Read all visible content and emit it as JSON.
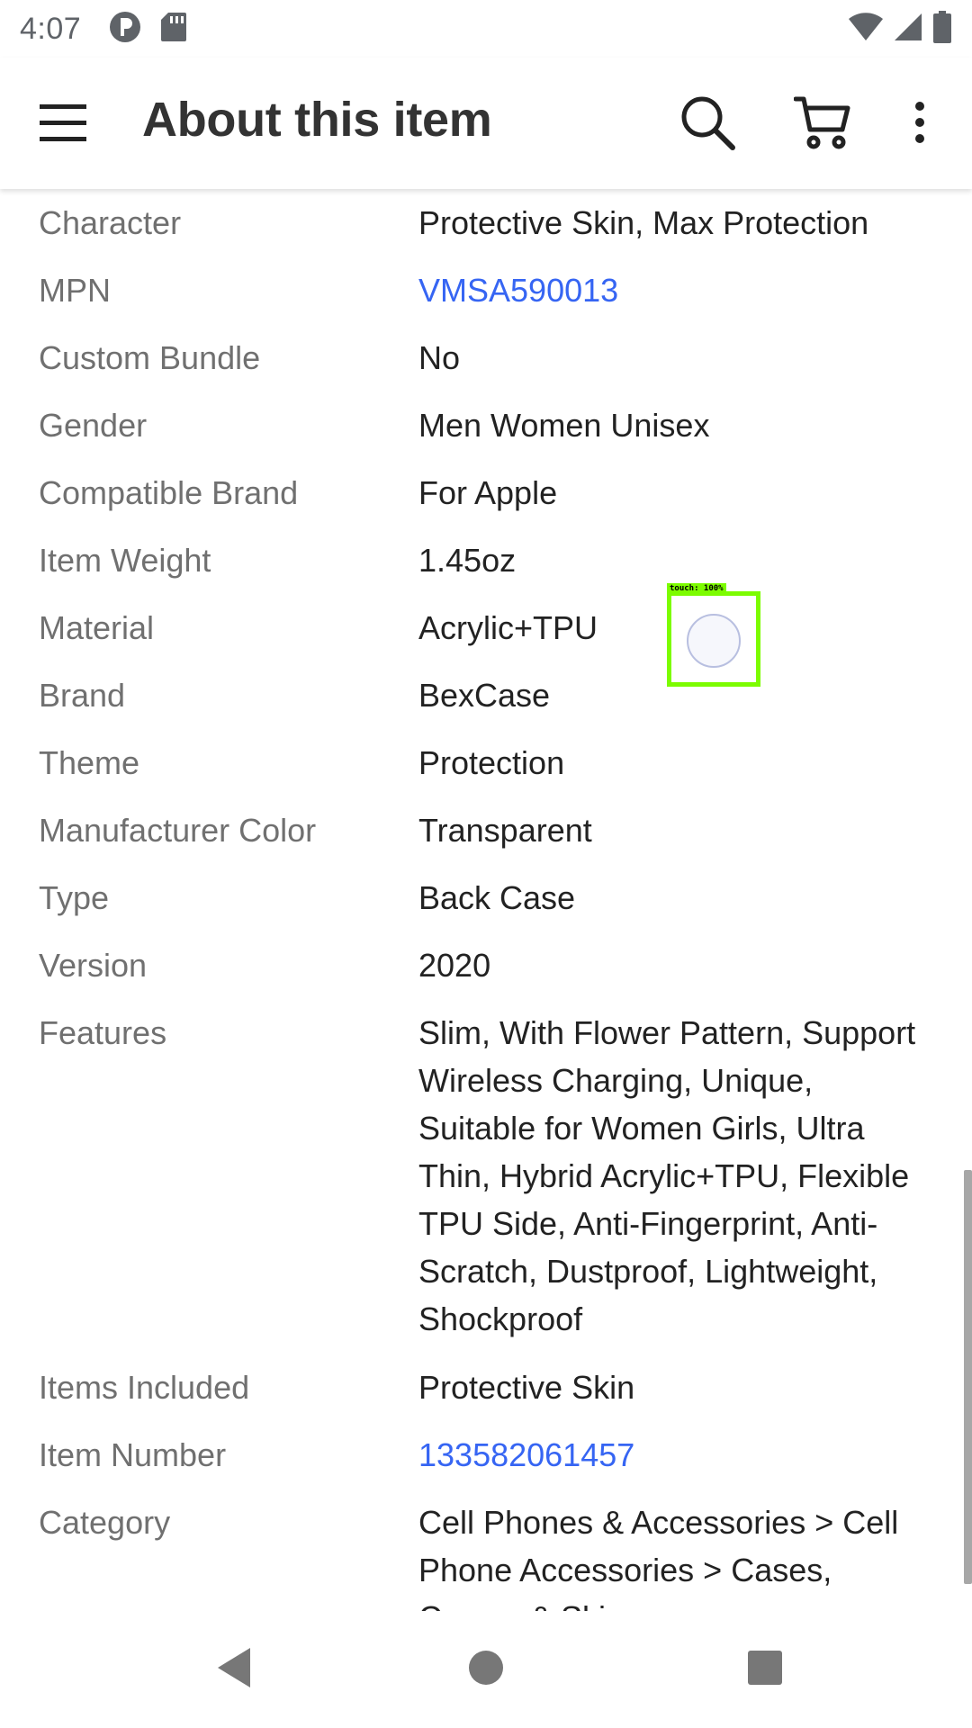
{
  "status_bar": {
    "time": "4:07"
  },
  "app_bar": {
    "title": "About this item",
    "icons": [
      "menu-icon",
      "search-icon",
      "cart-icon",
      "more-vert-icon"
    ]
  },
  "specs": [
    {
      "label": "Character",
      "value": "Protective Skin, Max Protection"
    },
    {
      "label": "MPN",
      "value": "VMSA590013",
      "link": true
    },
    {
      "label": "Custom Bundle",
      "value": "No"
    },
    {
      "label": "Gender",
      "value": "Men Women Unisex"
    },
    {
      "label": "Compatible Brand",
      "value": "For Apple"
    },
    {
      "label": "Item Weight",
      "value": "1.45oz"
    },
    {
      "label": "Material",
      "value": "Acrylic+TPU"
    },
    {
      "label": "Brand",
      "value": "BexCase"
    },
    {
      "label": "Theme",
      "value": "Protection"
    },
    {
      "label": "Manufacturer Color",
      "value": "Transparent"
    },
    {
      "label": "Type",
      "value": "Back Case"
    },
    {
      "label": "Version",
      "value": "2020"
    },
    {
      "label": "Features",
      "value": "Slim, With Flower Pattern, Support Wireless Charging, Unique, Suitable for Women Girls, Ultra Thin, Hybrid Acrylic+TPU, Flexible TPU Side, Anti-Fingerprint, Anti-Scratch, Dustproof, Lightweight, Shockproof"
    },
    {
      "label": "Items Included",
      "value": "Protective Skin"
    },
    {
      "label": "Item Number",
      "value": "133582061457",
      "link": true
    },
    {
      "label": "Category",
      "value": "Cell Phones & Accessories > Cell Phone Accessories > Cases, Covers & Skins"
    }
  ],
  "touch_overlay": {
    "label": "touch: 100%"
  },
  "colors": {
    "link": "#3665f3",
    "label": "#707070",
    "value": "#222222",
    "title": "#333333",
    "touch_box": "#7cfc00"
  }
}
